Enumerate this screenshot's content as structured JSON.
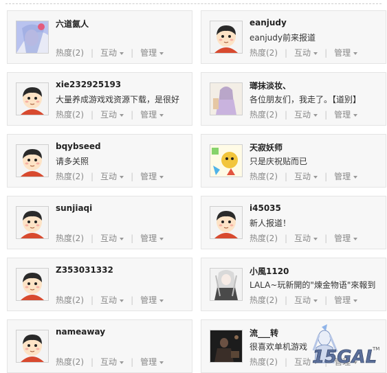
{
  "users": [
    {
      "name": "六道氤人",
      "status": "",
      "avatar": "anime-a"
    },
    {
      "name": "eanjudy",
      "status": "eanjudy前来报道",
      "avatar": "default"
    },
    {
      "name": "xie232925193",
      "status": "大量养成游戏戏资源下载，是很好",
      "avatar": "default"
    },
    {
      "name": "瑯抹淡妆、",
      "status": "各位朋友们，我走了。【道别】",
      "avatar": "anime-b"
    },
    {
      "name": "bqybseed",
      "status": "请多关照",
      "avatar": "default"
    },
    {
      "name": "天寂妖师",
      "status": "只是庆祝贴而已",
      "avatar": "anime-c"
    },
    {
      "name": "sunjiaqi",
      "status": "",
      "avatar": "default"
    },
    {
      "name": "i45035",
      "status": "新人报道！",
      "avatar": "default"
    },
    {
      "name": "Z353031332",
      "status": "",
      "avatar": "default"
    },
    {
      "name": "小風1120",
      "status": "LALA~玩新開的\"煉金物语\"來報到",
      "avatar": "anime-d"
    },
    {
      "name": "nameaway",
      "status": "",
      "avatar": "default"
    },
    {
      "name": "流___转",
      "status": "很喜欢单机游戏",
      "avatar": "anime-e"
    }
  ],
  "actions": {
    "heat": "热度(2)",
    "interact": "互动",
    "manage": "管理"
  },
  "watermark": "15GAL"
}
